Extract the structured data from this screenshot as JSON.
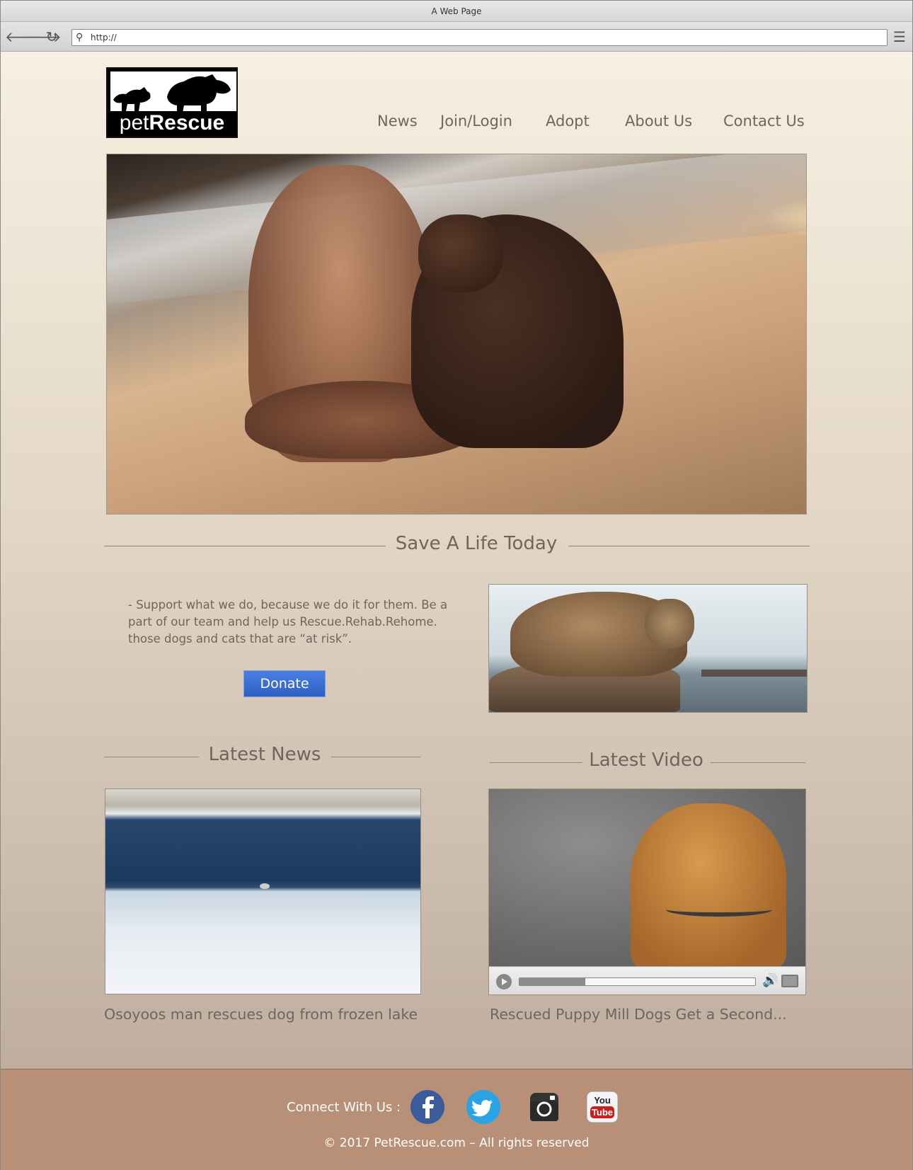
{
  "browser": {
    "window_title": "A Web Page",
    "url": "http://",
    "back_icon": "arrow-left-icon",
    "forward_icon": "arrow-right-icon",
    "reload_icon": "reload-icon",
    "menu_icon": "hamburger-menu-icon"
  },
  "header": {
    "logo_text_light": "pet",
    "logo_text_bold": "Rescue",
    "nav": [
      "News",
      "Join/Login",
      "Adopt",
      "About Us",
      "Contact Us"
    ]
  },
  "intro": {
    "title": "Save A Life Today",
    "text": "- Support what we do, because we do it for them. Be a part of our team and help us Rescue.Rehab.Rehome. those dogs and cats that are “at risk”.",
    "donate_label": "Donate"
  },
  "news": {
    "title": "Latest News",
    "caption": "Osoyoos man rescues dog from frozen lake"
  },
  "video": {
    "title": "Latest Video",
    "caption": "Rescued Puppy Mill Dogs Get a Second...",
    "progress": 0.28
  },
  "footer": {
    "connect_label": "Connect With Us :",
    "social": [
      "facebook-icon",
      "twitter-icon",
      "instagram-icon",
      "youtube-icon"
    ],
    "youtube_you": "You",
    "youtube_tube": "Tube",
    "copyright": "© 2017 PetRescue.com – All rights reserved"
  },
  "colors": {
    "text": "#6e665d",
    "donate": "#3a6fd6",
    "footer": "#b89077",
    "facebook": "#3b5b9a",
    "twitter": "#2aa3e6",
    "youtube": "#c8201e"
  }
}
